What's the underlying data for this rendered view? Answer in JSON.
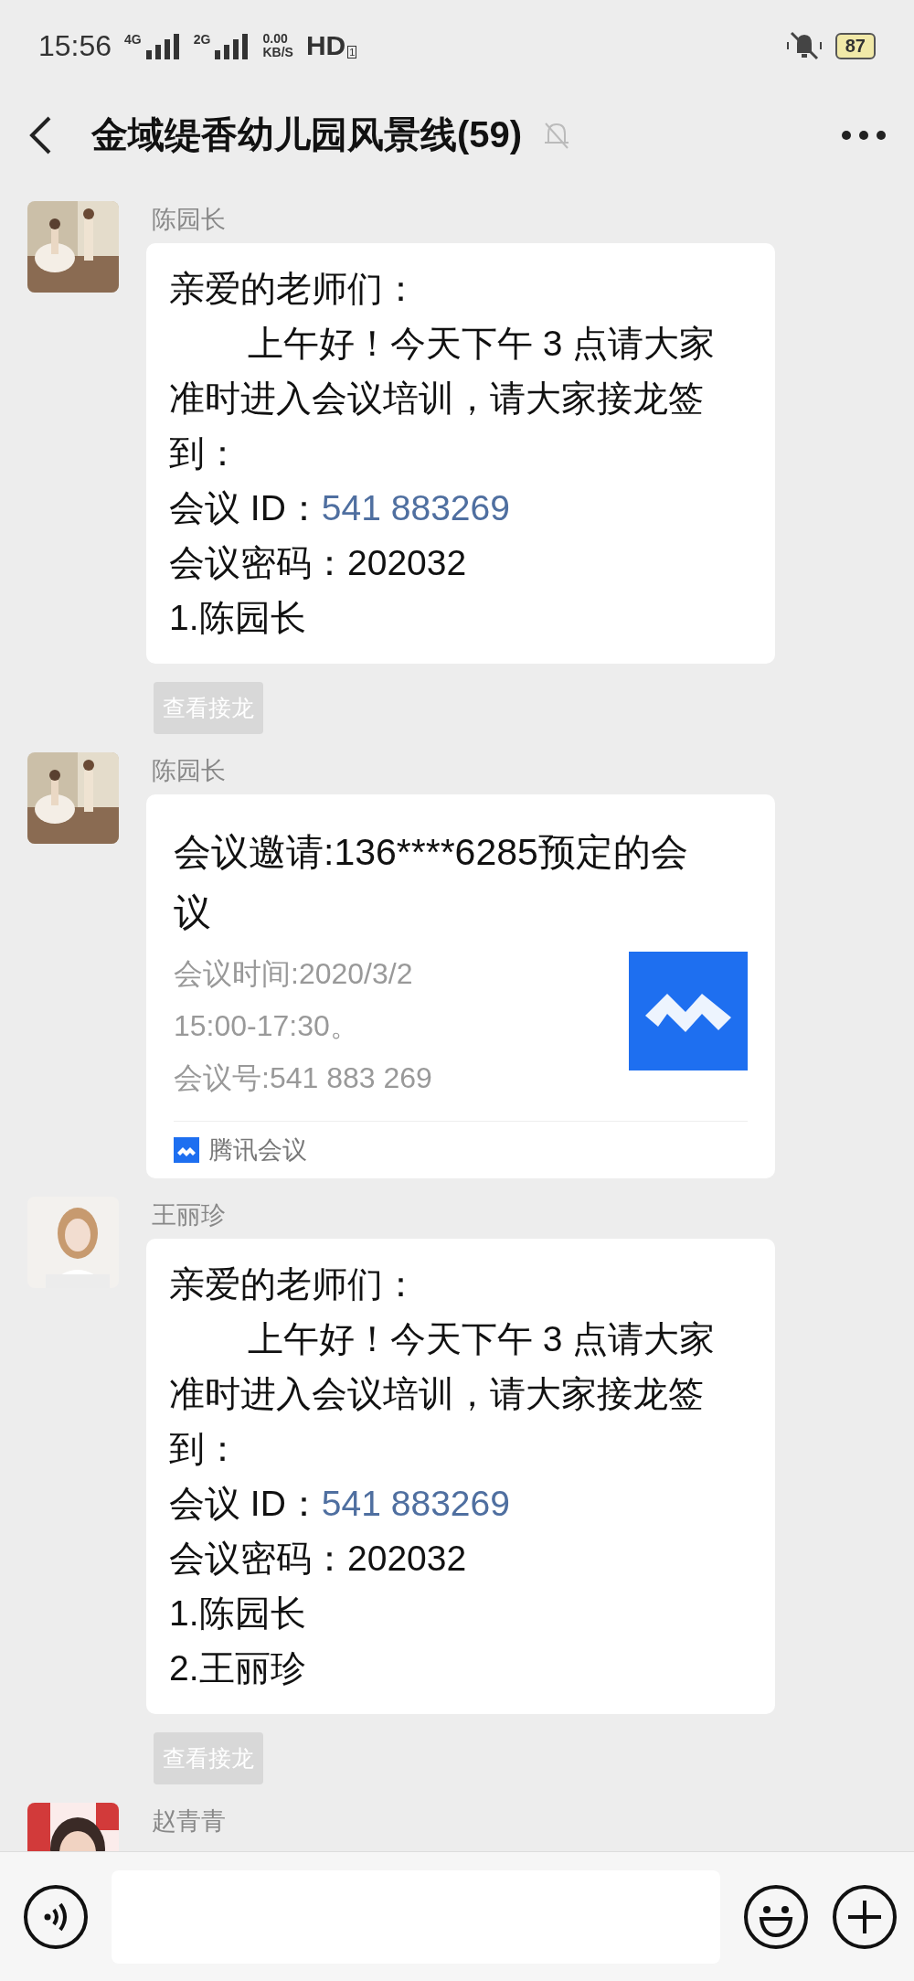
{
  "status_bar": {
    "time": "15:56",
    "networks": [
      "4G",
      "2G"
    ],
    "speed": "0.00",
    "speed_unit": "KB/S",
    "hd": "HD",
    "sim": "1",
    "battery": "87"
  },
  "header": {
    "title": "金域缇香幼儿园风景线(59)",
    "muted": true
  },
  "messages": [
    {
      "kind": "text",
      "sender": "陈园长",
      "avatar": {
        "kind": "picture"
      },
      "greeting": "亲爱的老师们：",
      "body": "上午好！今天下午 3 点请大家准时进入会议培训，请大家接龙签到：",
      "id_label": "会议 ID：",
      "id_value": "541 883269",
      "password": "会议密码：202032",
      "entries": [
        "1.陈园长"
      ],
      "action": "查看接龙"
    },
    {
      "kind": "card",
      "sender": "陈园长",
      "avatar": {
        "kind": "picture"
      },
      "title": "会议邀请:136****6285预定的会议",
      "details": [
        "会议时间:2020/3/2",
        "15:00-17:30。",
        "会议号:541 883 269"
      ],
      "source": "腾讯会议"
    },
    {
      "kind": "text",
      "sender": "王丽珍",
      "avatar": {
        "kind": "picture"
      },
      "greeting": "亲爱的老师们：",
      "body": "上午好！今天下午 3 点请大家准时进入会议培训，请大家接龙签到：",
      "id_label": "会议 ID：",
      "id_value": "541 883269",
      "password": "会议密码：202032",
      "entries": [
        "1.陈园长",
        "2.王丽珍"
      ],
      "action": "查看接龙"
    },
    {
      "kind": "partial",
      "sender": "赵青青",
      "avatar": {
        "kind": "picture"
      }
    }
  ]
}
